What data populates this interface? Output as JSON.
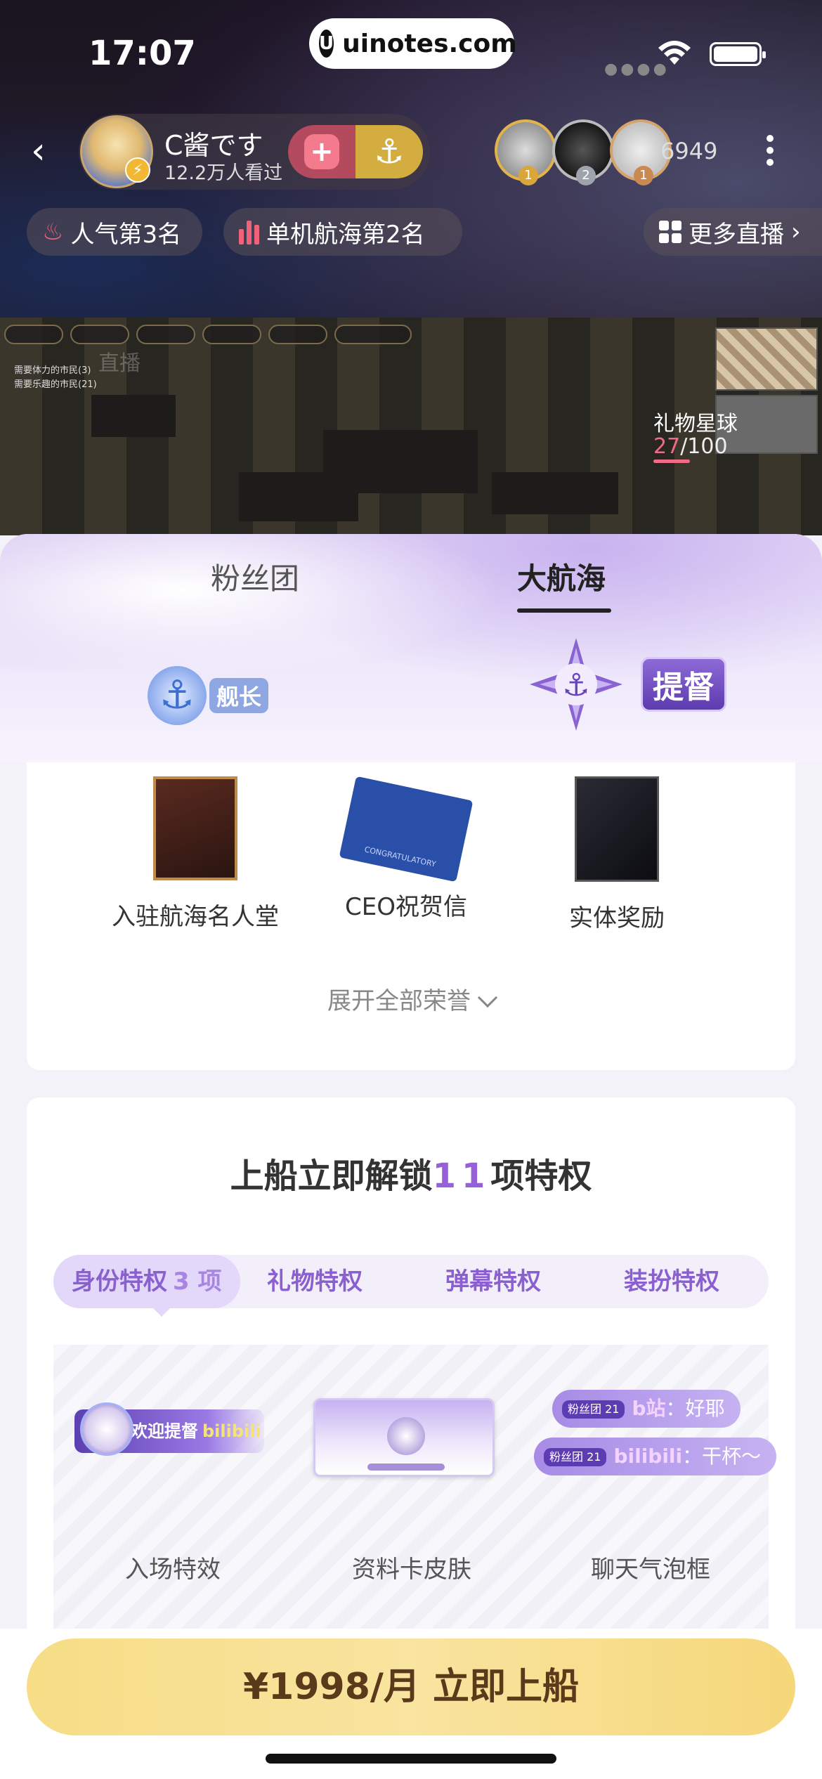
{
  "status_bar": {
    "time": "17:07",
    "url": "uinotes.com"
  },
  "live_header": {
    "anchor_name": "C酱です",
    "views": "12.2万人看过",
    "online_count": "6949",
    "rank_numbers": [
      "1",
      "2",
      "1"
    ],
    "tags": {
      "popularity": "人气第3名",
      "category_rank": "单机航海第2名",
      "more_live": "更多直播"
    },
    "video": {
      "watermark": "直播",
      "tip_1": "需要体力的市民(3)",
      "tip_2": "需要乐趣的市民(21)",
      "gift_star_label": "礼物星球",
      "gift_current": "27",
      "gift_total": "/100"
    }
  },
  "sheet": {
    "tabs": [
      {
        "label": "粉丝团"
      },
      {
        "label": "大航海"
      }
    ],
    "levels": {
      "captain": "舰长",
      "admiral": "提督"
    },
    "honors": {
      "items": [
        {
          "label": "入驻航海名人堂"
        },
        {
          "label": "CEO祝贺信"
        },
        {
          "label": "实体奖励"
        }
      ],
      "envelope_text": "CONGRATULATORY",
      "expand_label": "展开全部荣誉"
    },
    "privileges": {
      "title_prefix": "上船立即解锁",
      "title_number": "11",
      "title_suffix": "项特权",
      "categories": [
        {
          "label": "身份特权",
          "count": "3 项"
        },
        {
          "label": "礼物特权"
        },
        {
          "label": "弹幕特权"
        },
        {
          "label": "装扮特权"
        }
      ],
      "items": [
        {
          "label": "入场特效"
        },
        {
          "label": "资料卡皮肤"
        },
        {
          "label": "聊天气泡框"
        }
      ],
      "entry_effect_text": "欢迎提督",
      "entry_effect_brand": "bilibili",
      "bubbles": [
        {
          "fan_badge": "粉丝团 21",
          "site": "b站",
          "text": "：好耶"
        },
        {
          "fan_badge": "粉丝团 21",
          "site": "bilibili",
          "text": "：干杯～"
        }
      ]
    }
  },
  "bottom": {
    "buy_label": "¥1998/月 立即上船"
  },
  "colors": {
    "accent_purple": "#9560d8",
    "buy_button": "#f6dd86",
    "popularity_pink": "#f0627a"
  }
}
